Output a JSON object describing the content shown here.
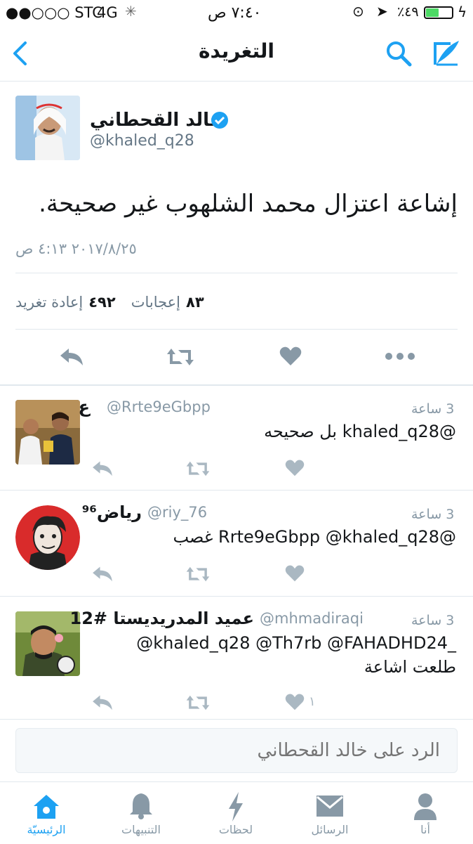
{
  "status": {
    "carrier": "●●○○○ STC",
    "network": "4G",
    "time": "٧:٤٠ ص",
    "battery": "٪٤٩"
  },
  "nav": {
    "title": "التغريدة"
  },
  "tweet": {
    "name": "خالد القحطاني",
    "handle": "@khaled_q28",
    "text": "إشاعة اعتزال محمد الشلهوب غير صحيحة.",
    "timestamp": "٢٠١٧/٨/٢٥ ٤:١٣ ص",
    "likes_count": "٨٣",
    "likes_label": "إعجابات",
    "retweets_count": "٤٩٢",
    "retweets_label": "إعادة تغريد"
  },
  "replies": [
    {
      "name": "ع",
      "handle": "@Rrte9eGbpp",
      "time": "3 ساعة",
      "text": "@khaled_q28 بل صحيحه",
      "likes": ""
    },
    {
      "name": "رياض⁹⁶",
      "handle": "@riy_76",
      "time": "3 ساعة",
      "text": "@Rrte9eGbpp @khaled_q28 غصب",
      "likes": ""
    },
    {
      "name": "عميد المدريديستا #12",
      "handle": "@mhmadiraqi",
      "time": "3 ساعة",
      "text_line1": "@khaled_q28 @Th7rb @FAHADHD24_",
      "text_line2": "طلعت اشاعة",
      "likes": "١"
    }
  ],
  "composer": {
    "placeholder": "الرد على خالد القحطاني"
  },
  "tabs": {
    "home": "الرئيسيّة",
    "notifications": "التنبيهات",
    "moments": "لحظات",
    "messages": "الرسائل",
    "me": "أنا"
  },
  "colors": {
    "brand": "#1da1f2",
    "icon_gray": "#8899a6",
    "battery": "#4cd964"
  }
}
